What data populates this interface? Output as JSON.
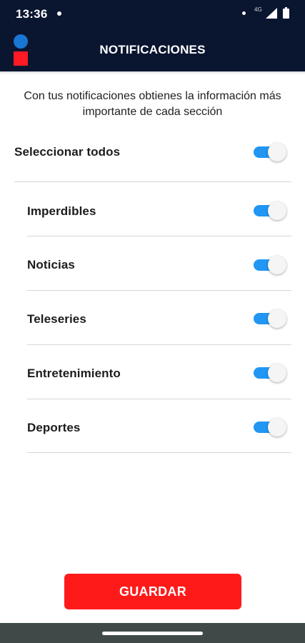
{
  "status_bar": {
    "time": "13:36",
    "network": "4G",
    "icons": [
      "notification-dot-icon",
      "signal-icon",
      "battery-icon"
    ]
  },
  "header": {
    "title": "NOTIFICACIONES",
    "logo_colors": {
      "circle": "#1976d2",
      "square": "#ff1a24"
    }
  },
  "intro_text": "Con tus notificaciones obtienes la información más importante de cada sección",
  "select_all": {
    "label": "Seleccionar todos",
    "checked": true
  },
  "categories": [
    {
      "label": "Imperdibles",
      "checked": true
    },
    {
      "label": "Noticias",
      "checked": true
    },
    {
      "label": "Teleseries",
      "checked": true
    },
    {
      "label": "Entretenimiento",
      "checked": true
    },
    {
      "label": "Deportes",
      "checked": true
    }
  ],
  "save_button": {
    "label": "GUARDAR"
  },
  "colors": {
    "header_bg": "#0a1530",
    "toggle_on": "#2196f3",
    "button_bg": "#ff1a1a"
  }
}
